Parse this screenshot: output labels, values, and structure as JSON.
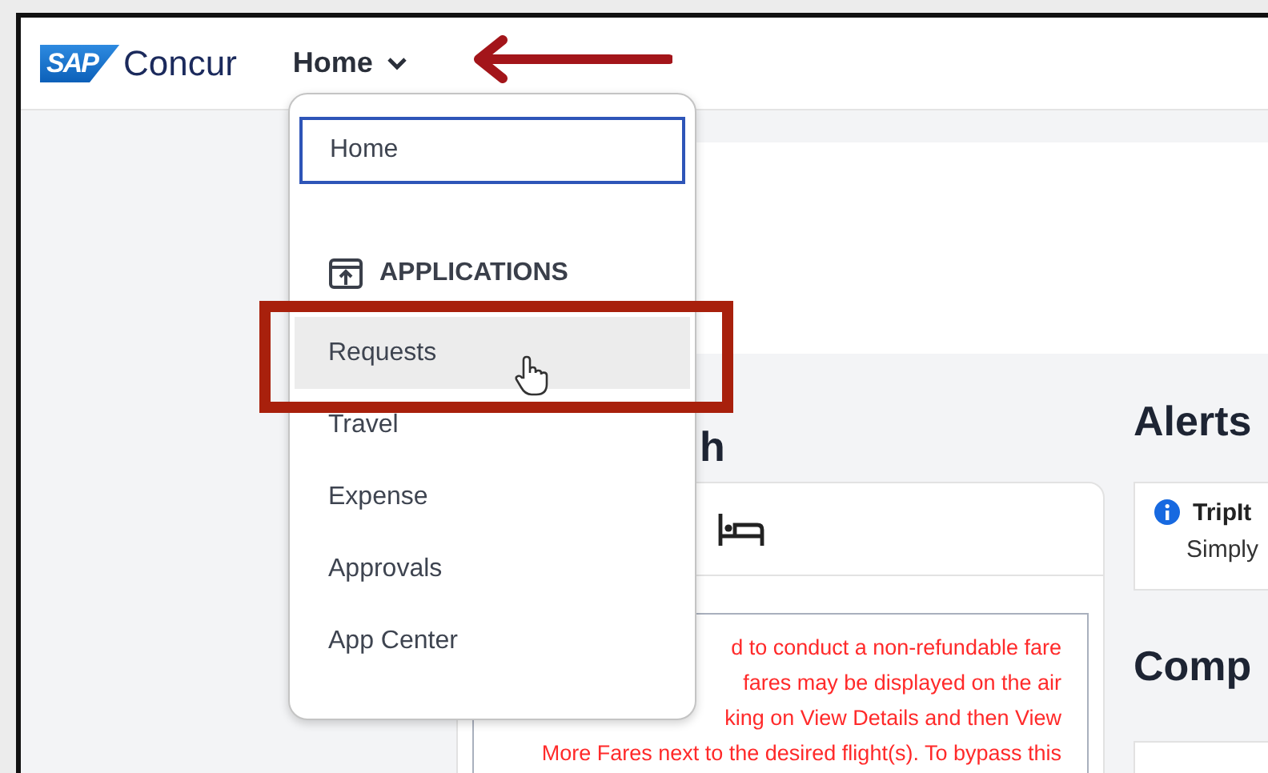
{
  "header": {
    "logo": {
      "badge": "SAP",
      "name": "Concur"
    },
    "nav": {
      "label": "Home",
      "expanded": true
    }
  },
  "menu": {
    "entries": [
      {
        "kind": "item",
        "label": "Home",
        "focused": true,
        "hovered": false
      },
      {
        "kind": "section",
        "label": "APPLICATIONS"
      },
      {
        "kind": "item",
        "label": "Requests",
        "focused": false,
        "hovered": true
      },
      {
        "kind": "item",
        "label": "Travel",
        "focused": false,
        "hovered": false
      },
      {
        "kind": "item",
        "label": "Expense",
        "focused": false,
        "hovered": false
      },
      {
        "kind": "item",
        "label": "Approvals",
        "focused": false,
        "hovered": false
      },
      {
        "kind": "item",
        "label": "App Center",
        "focused": false,
        "hovered": false
      }
    ]
  },
  "search_panel": {
    "heading": "h",
    "message_lines": [
      "d to conduct a non-refundable fare",
      "fares may be displayed on the air",
      "king on View Details and then View",
      "More Fares next to the desired flight(s). To bypass this"
    ]
  },
  "alerts": {
    "heading": "Alerts",
    "items": [
      {
        "title": "TripIt",
        "text": "Simply"
      }
    ]
  },
  "company": {
    "heading": "Comp"
  }
}
